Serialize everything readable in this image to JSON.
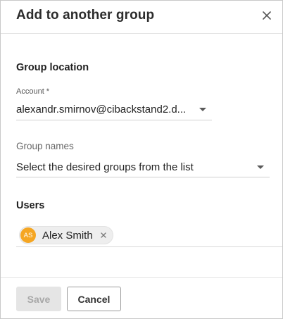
{
  "dialog": {
    "title": "Add to another group"
  },
  "group_location": {
    "section_title": "Group location",
    "account_label": "Account *",
    "account_value": "alexandr.smirnov@cibackstand2.d..."
  },
  "group_names": {
    "label": "Group names",
    "placeholder": "Select the desired groups from the list"
  },
  "users": {
    "section_title": "Users",
    "chips": [
      {
        "initials": "AS",
        "name": "Alex Smith",
        "avatar_color": "#f5a623"
      }
    ]
  },
  "footer": {
    "save_label": "Save",
    "cancel_label": "Cancel"
  },
  "colors": {
    "avatar": "#f5a623",
    "disabled_button_bg": "#e5e5e5",
    "disabled_button_text": "#a8a8a8"
  },
  "icons": {
    "close": "close-icon",
    "dropdown": "chevron-down-icon",
    "chip_remove": "close-icon"
  }
}
